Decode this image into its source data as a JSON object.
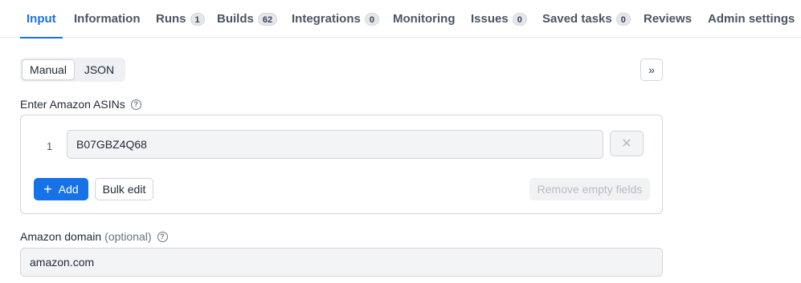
{
  "tabs": [
    {
      "label": "Input",
      "badge": null,
      "active": true
    },
    {
      "label": "Information",
      "badge": null
    },
    {
      "label": "Runs",
      "badge": "1"
    },
    {
      "label": "Builds",
      "badge": "62"
    },
    {
      "label": "Integrations",
      "badge": "0"
    },
    {
      "label": "Monitoring",
      "badge": null
    },
    {
      "label": "Issues",
      "badge": "0"
    },
    {
      "label": "Saved tasks",
      "badge": "0"
    },
    {
      "label": "Reviews",
      "badge": null
    },
    {
      "label": "Admin settings",
      "badge": null
    }
  ],
  "mode": {
    "manual": "Manual",
    "json": "JSON",
    "selected": "Manual"
  },
  "collapse_icon": "»",
  "asins": {
    "label": "Enter Amazon ASINs",
    "rows": [
      {
        "index": "1",
        "value": "B07GBZ4Q68"
      }
    ],
    "add_label": "Add",
    "bulk_edit_label": "Bulk edit",
    "remove_empty_label": "Remove empty fields"
  },
  "domain": {
    "label": "Amazon domain",
    "optional": "(optional)",
    "value": "amazon.com"
  },
  "colors": {
    "accent": "#1672e6"
  }
}
